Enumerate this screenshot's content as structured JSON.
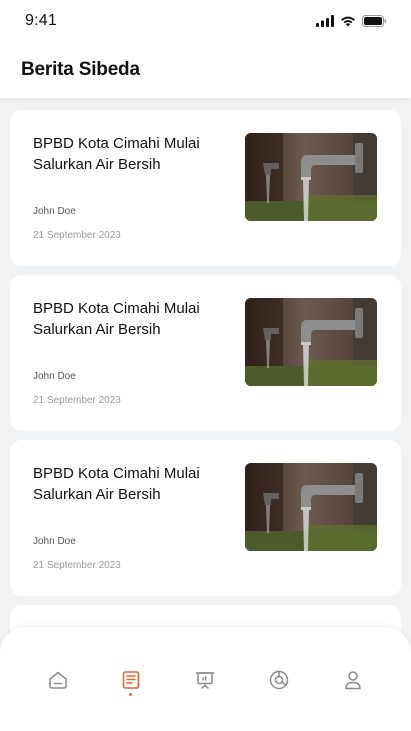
{
  "status_bar": {
    "time": "9:41"
  },
  "header": {
    "title": "Berita Sibeda"
  },
  "news": [
    {
      "title": "BPBD Kota Cimahi Mulai Salurkan Air Bersih",
      "author": "John Doe",
      "date": "21 September 2023",
      "image": "water-tap-photo"
    },
    {
      "title": "BPBD Kota Cimahi Mulai Salurkan Air Bersih",
      "author": "John Doe",
      "date": "21 September 2023",
      "image": "water-tap-photo"
    },
    {
      "title": "BPBD Kota Cimahi Mulai Salurkan Air Bersih",
      "author": "John Doe",
      "date": "21 September 2023",
      "image": "water-tap-photo"
    }
  ],
  "bottom_nav": {
    "items": [
      {
        "icon": "home-icon",
        "active": false
      },
      {
        "icon": "news-icon",
        "active": true
      },
      {
        "icon": "presentation-icon",
        "active": false
      },
      {
        "icon": "chart-pie-icon",
        "active": false
      },
      {
        "icon": "profile-icon",
        "active": false
      }
    ],
    "active_color": "#e8652b",
    "inactive_color": "#8a8a8a"
  }
}
